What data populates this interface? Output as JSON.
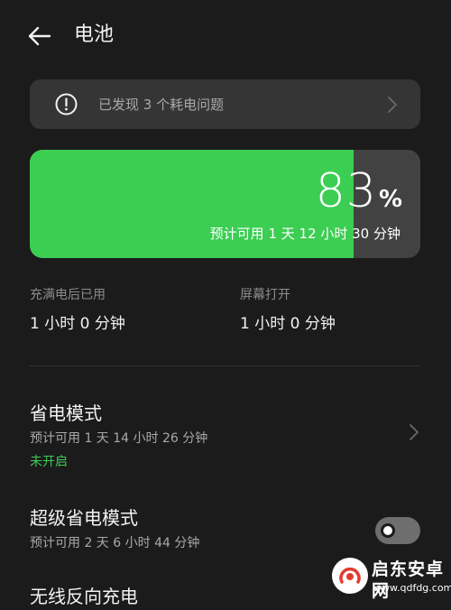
{
  "header": {
    "title": "电池"
  },
  "alert": {
    "text": "已发现 3 个耗电问题"
  },
  "battery": {
    "level": 83,
    "percent_number": "83",
    "percent_unit": "%",
    "estimate": "预计可用 1 天 12 小时 30 分钟"
  },
  "stats": [
    {
      "label": "充满电后已用",
      "value": "1 小时 0 分钟"
    },
    {
      "label": "屏幕打开",
      "value": "1 小时 0 分钟"
    }
  ],
  "power_saving": {
    "title": "省电模式",
    "estimate": "预计可用 1 天 14 小时 26 分钟",
    "status": "未开启"
  },
  "super_power_saving": {
    "title": "超级省电模式",
    "estimate": "预计可用 2 天 6 小时 44 分钟",
    "enabled": false
  },
  "reverse_charging": {
    "title": "无线反向充电"
  },
  "watermark": {
    "title": "启东安卓网",
    "url": "www.qdfdg.com"
  },
  "colors": {
    "accent": "#3ccd53",
    "background": "#1b1b1b",
    "card": "#353535",
    "battery_track": "#424242"
  },
  "icons": {
    "back": "arrow-left-icon",
    "alert": "exclamation-circle-icon",
    "chevron": "chevron-right-icon"
  }
}
